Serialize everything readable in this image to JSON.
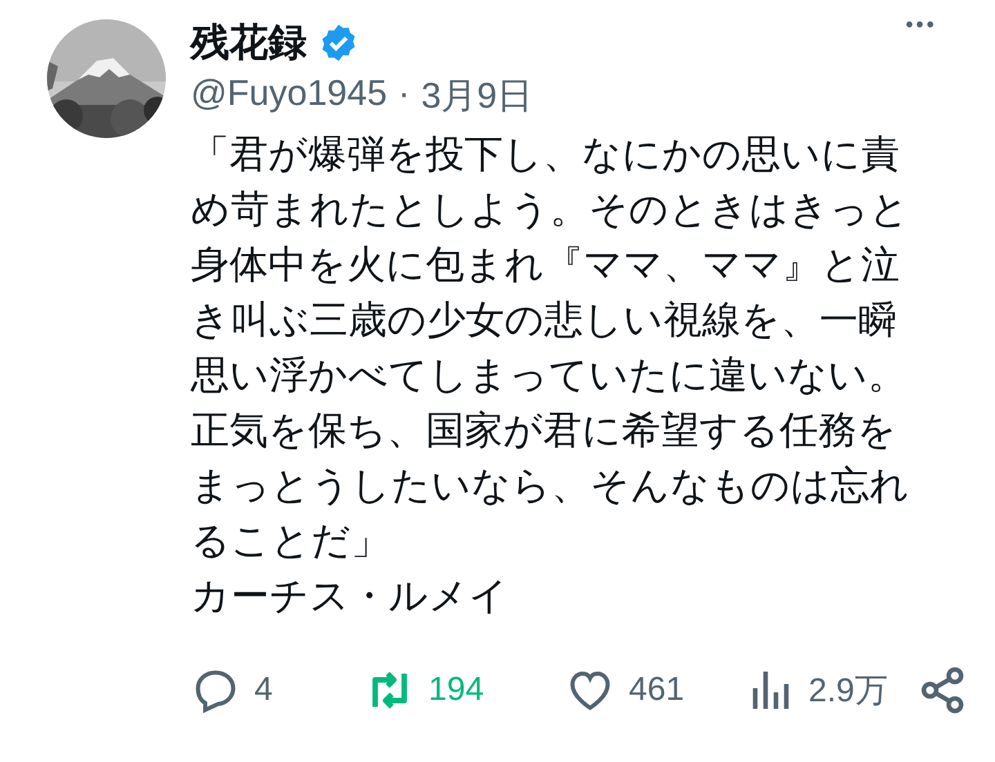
{
  "post": {
    "author": {
      "name": "残花録",
      "verified": true,
      "handle": "@Fuyo1945",
      "separator": "·",
      "date": "3月9日"
    },
    "more": "•••",
    "body_lines": [
      "「君が爆弾を投下し、なにかの思いに責",
      "め苛まれたとしよう。そのときはきっと",
      "身体中を火に包まれ『ママ、ママ』と泣",
      "き叫ぶ三歳の少女の悲しい視線を、一瞬",
      "思い浮かべてしまっていたに違いない。",
      "正気を保ち、国家が君に希望する任務を",
      "まっとうしたいなら、そんなものは忘れ",
      "ることだ」",
      "カーチス・ルメイ"
    ],
    "actions": [
      {
        "kind": "reply",
        "count": "4",
        "on": false
      },
      {
        "kind": "repost",
        "count": "194",
        "on": true
      },
      {
        "kind": "like",
        "count": "461",
        "on": false
      },
      {
        "kind": "views",
        "count": "2.9万",
        "on": false
      },
      {
        "kind": "share",
        "on": false
      }
    ]
  }
}
